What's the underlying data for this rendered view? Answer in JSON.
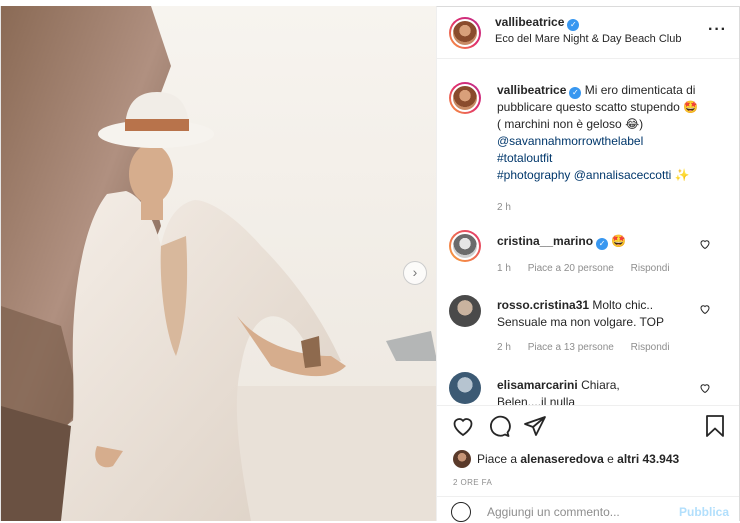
{
  "post": {
    "username": "vallibeatrice",
    "location": "Eco del Mare Night & Day Beach Club"
  },
  "caption": {
    "username": "vallibeatrice",
    "line1": "Mi ero dimenticata di",
    "line2": "pubblicare questo scatto stupendo 🤩",
    "line3": "( marchini non è geloso 😂)",
    "tag1": "@savannahmorrowthelabel",
    "tag2": "#totaloutfit",
    "tag3": "#photography",
    "tag4": "@annalisaceccotti",
    "tag4_suffix": "✨",
    "time": "2 h"
  },
  "comments": [
    {
      "username": "cristina__marino",
      "text": "🤩",
      "time": "1 h",
      "likes": "Piace a 20 persone",
      "reply": "Rispondi"
    },
    {
      "username": "rosso.cristina31",
      "text": "Molto chic..",
      "text2": "Sensuale ma non volgare. TOP",
      "time": "2 h",
      "likes": "Piace a 13 persone",
      "reply": "Rispondi"
    },
    {
      "username": "elisamarcarini",
      "text": "Chiara,",
      "text2": "Belen....il nulla"
    }
  ],
  "likes": {
    "prefix": "Piace a",
    "user": "alenaseredova",
    "middle": "e",
    "others": "altri 43.943"
  },
  "time_ago": "2 ORE FA",
  "add_comment": {
    "placeholder": "Aggiungi un commento...",
    "publish": "Pubblica"
  },
  "icons": {
    "more": "more-icon",
    "heart": "heart-icon",
    "comment": "comment-icon",
    "share": "share-icon",
    "save": "bookmark-icon",
    "next": "chevron-right-icon",
    "emoji": "emoji-icon"
  },
  "colors": {
    "link": "#00376b",
    "meta": "#8e8e8e",
    "verified": "#3897f0",
    "publish": "#b2dffc"
  }
}
